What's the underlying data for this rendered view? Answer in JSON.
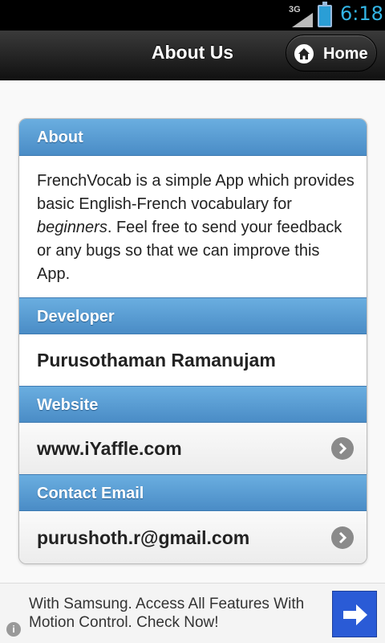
{
  "status_bar": {
    "network": "3G",
    "time": "6:18"
  },
  "header": {
    "title": "About Us",
    "home_label": "Home"
  },
  "sections": {
    "about": {
      "heading": "About",
      "text_before": "FrenchVocab is a simple App which provides basic English-French vocabulary for ",
      "text_emphasis": "beginners",
      "text_after": ". Feel free to send your feedback or any bugs so that we can improve this App."
    },
    "developer": {
      "heading": "Developer",
      "value": "Purusothaman Ramanujam"
    },
    "website": {
      "heading": "Website",
      "value": "www.iYaffle.com"
    },
    "contact": {
      "heading": "Contact Email",
      "value": "purushoth.r@gmail.com"
    }
  },
  "ad": {
    "text": "With Samsung. Access All Features With Motion Control. Check Now!",
    "info_icon": "i"
  },
  "colors": {
    "section_header": "#4a8cc6",
    "header_bar": "#1a1a1a",
    "time": "#33b5e5"
  },
  "icons": {
    "home": "home-icon",
    "chevron": "chevron-right-icon",
    "ad_arrow": "arrow-right-icon"
  }
}
